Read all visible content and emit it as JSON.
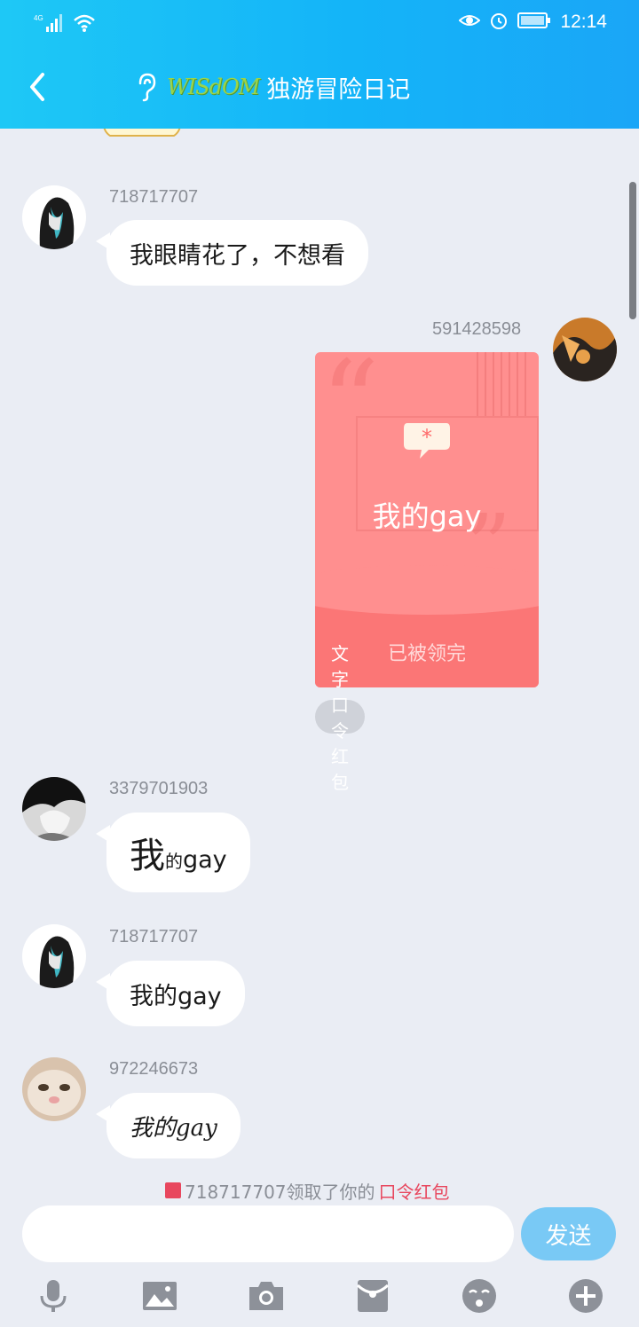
{
  "statusbar": {
    "network": "4G",
    "time": "12:14"
  },
  "header": {
    "logo_text": "WISdOM",
    "title": "独游冒险日记"
  },
  "messages": [
    {
      "username": "718717707",
      "text": "我眼睛花了，不想看"
    },
    {
      "username": "591428598",
      "card_text": "我的gay",
      "card_status": "已被领完",
      "tag": "文字口令红包"
    },
    {
      "username": "3379701903",
      "text_big": "我",
      "text_small": "的",
      "text_tail": "gay"
    },
    {
      "username": "718717707",
      "text": "我的gay"
    },
    {
      "username": "972246673",
      "text": "我的gay"
    }
  ],
  "notice": {
    "prefix": "718717707领取了你的",
    "highlight": "口令红包"
  },
  "input": {
    "value": "",
    "placeholder": ""
  },
  "send_label": "发送",
  "toolbar": [
    "mic-icon",
    "image-icon",
    "camera-icon",
    "red-envelope-icon",
    "emoji-icon",
    "plus-icon"
  ]
}
